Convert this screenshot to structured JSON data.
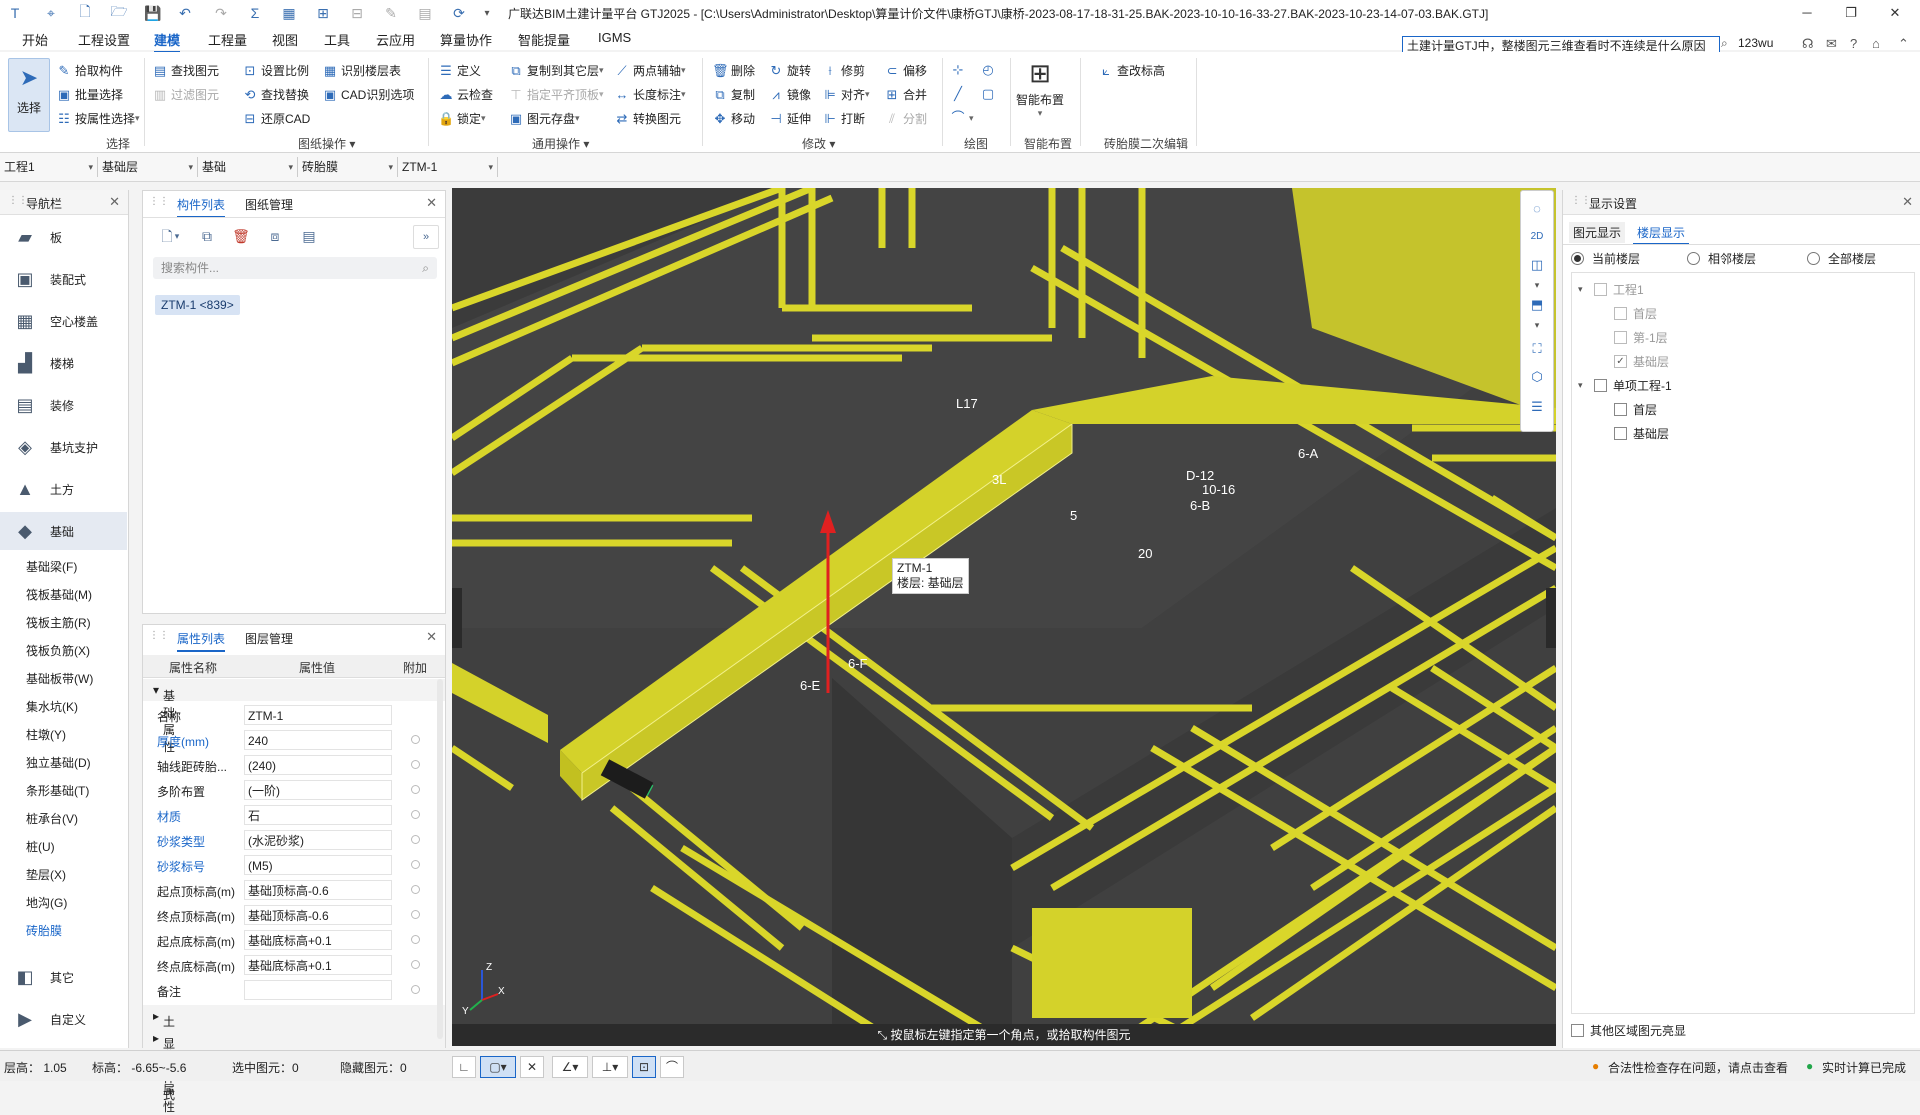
{
  "title": {
    "text": "广联达BIM土建计量平台 GTJ2025 - [C:\\Users\\Administrator\\Desktop\\算量计价文件\\康桥GTJ\\康桥-2023-08-17-18-31-25.BAK-2023-10-10-16-33-27.BAK-2023-10-23-14-07-03.BAK.GTJ]"
  },
  "menu": {
    "tabs": [
      "开始",
      "工程设置",
      "建模",
      "工程量",
      "视图",
      "工具",
      "云应用",
      "算量协作",
      "智能提量",
      "IGMS"
    ],
    "search_text": "土建计量GTJ中，整楼图元三维查看时不连续是什么原因",
    "user": "123wu"
  },
  "ribbon": {
    "select_big": "选择",
    "select_items": [
      "拾取构件",
      "批量选择",
      "按属性选择"
    ],
    "select_group": "选择",
    "drawing_items": [
      "查找图元",
      "过滤图元",
      "设置比例",
      "查找替换",
      "还原CAD",
      "识别楼层表",
      "CAD识别选项"
    ],
    "drawing_group": "图纸操作",
    "common_items": [
      "定义",
      "云检查",
      "锁定",
      "复制到其它层",
      "指定平齐顶板",
      "图元存盘",
      "两点辅轴",
      "长度标注",
      "转换图元"
    ],
    "common_group": "通用操作",
    "modify_items": [
      "删除",
      "旋转",
      "修剪",
      "偏移",
      "复制",
      "镜像",
      "对齐",
      "合并",
      "移动",
      "延伸",
      "打断",
      "分割"
    ],
    "modify_group": "修改",
    "draw_group": "绘图",
    "smart_big": "智能布置",
    "smart_group": "智能布置",
    "edit_item": "查改标高",
    "edit_group": "砖胎膜二次编辑"
  },
  "selectors": [
    "工程1",
    "基础层",
    "基础",
    "砖胎膜",
    "ZTM-1"
  ],
  "nav": {
    "title": "导航栏",
    "categories": [
      {
        "label": "板",
        "icon": "slab-icon"
      },
      {
        "label": "装配式",
        "icon": "prefab-icon"
      },
      {
        "label": "空心楼盖",
        "icon": "hollow-floor-icon"
      },
      {
        "label": "楼梯",
        "icon": "stair-icon"
      },
      {
        "label": "装修",
        "icon": "decoration-icon"
      },
      {
        "label": "基坑支护",
        "icon": "pit-support-icon"
      },
      {
        "label": "土方",
        "icon": "earthwork-icon"
      },
      {
        "label": "基础",
        "icon": "foundation-icon"
      }
    ],
    "subitems": [
      "基础梁(F)",
      "筏板基础(M)",
      "筏板主筋(R)",
      "筏板负筋(X)",
      "基础板带(W)",
      "集水坑(K)",
      "柱墩(Y)",
      "独立基础(D)",
      "条形基础(T)",
      "桩承台(V)",
      "桩(U)",
      "垫层(X)",
      "地沟(G)",
      "砖胎膜"
    ],
    "bottom": [
      {
        "label": "其它",
        "icon": "other-icon"
      },
      {
        "label": "自定义",
        "icon": "custom-icon"
      }
    ]
  },
  "component_panel": {
    "tabs": [
      "构件列表",
      "图纸管理"
    ],
    "search_placeholder": "搜索构件...",
    "item": "ZTM-1 <839>"
  },
  "props": {
    "tabs": [
      "属性列表",
      "图层管理"
    ],
    "headers": [
      "属性名称",
      "属性值",
      "附加"
    ],
    "group": "基础属性",
    "rows": [
      {
        "name": "名称",
        "value": "ZTM-1",
        "blue": false
      },
      {
        "name": "厚度(mm)",
        "value": "240",
        "blue": true
      },
      {
        "name": "轴线距砖胎...",
        "value": "(240)",
        "blue": false
      },
      {
        "name": "多阶布置",
        "value": "(一阶)",
        "blue": false
      },
      {
        "name": "材质",
        "value": "石",
        "blue": true
      },
      {
        "name": "砂浆类型",
        "value": "(水泥砂浆)",
        "blue": true
      },
      {
        "name": "砂浆标号",
        "value": "(M5)",
        "blue": true
      },
      {
        "name": "起点顶标高(m)",
        "value": "基础顶标高-0.6",
        "blue": false
      },
      {
        "name": "终点顶标高(m)",
        "value": "基础顶标高-0.6",
        "blue": false
      },
      {
        "name": "起点底标高(m)",
        "value": "基础底标高+0.1",
        "blue": false
      },
      {
        "name": "终点底标高(m)",
        "value": "基础底标高+0.1",
        "blue": false
      },
      {
        "name": "备注",
        "value": "",
        "blue": false
      }
    ],
    "groups_bottom": [
      "土建业务属性",
      "显示样式"
    ]
  },
  "viewport": {
    "tip_line1": "ZTM-1",
    "tip_line2": "楼层: 基础层",
    "status": "按鼠标左键指定第一个角点，或拾取构件图元",
    "labels": [
      "L17",
      "3L",
      "D-12",
      "10-16",
      "6-A",
      "6-B",
      "5",
      "20",
      "6-F",
      "6-E"
    ],
    "colors": {
      "bg": "#3b3b3b",
      "slab": "#464646",
      "beam": "#d9d62a",
      "beam_edge": "#f0ee70"
    }
  },
  "display": {
    "title": "显示设置",
    "tabs": [
      "图元显示",
      "楼层显示"
    ],
    "radios": [
      "当前楼层",
      "相邻楼层",
      "全部楼层"
    ],
    "tree": [
      {
        "label": "工程1",
        "level": 0,
        "checked": false,
        "grey": true
      },
      {
        "label": "首层",
        "level": 1,
        "checked": false,
        "grey": true
      },
      {
        "label": "第-1层",
        "level": 1,
        "checked": false,
        "grey": true
      },
      {
        "label": "基础层",
        "level": 1,
        "checked": true,
        "grey": true
      },
      {
        "label": "单项工程-1",
        "level": 0,
        "checked": false,
        "grey": false
      },
      {
        "label": "首层",
        "level": 1,
        "checked": false,
        "grey": false
      },
      {
        "label": "基础层",
        "level": 1,
        "checked": false,
        "grey": false
      }
    ],
    "footer": "其他区域图元亮显"
  },
  "status": {
    "floor_height": "层高：  1.05",
    "elevation": "标高：  -6.65~-5.6",
    "selected": "选中图元：0",
    "hidden": "隐藏图元：0",
    "warning": "合法性检查存在问题，请点击查看",
    "realtime": "实时计算已完成"
  }
}
